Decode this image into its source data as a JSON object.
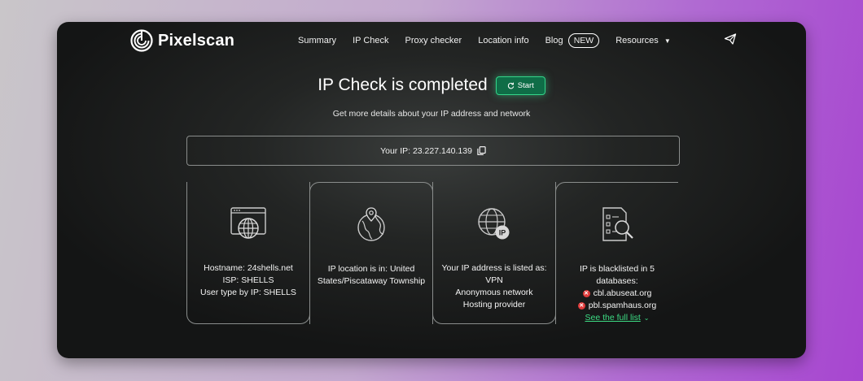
{
  "brand": {
    "name": "Pixelscan"
  },
  "nav": {
    "items": [
      {
        "label": "Summary"
      },
      {
        "label": "IP Check"
      },
      {
        "label": "Proxy checker"
      },
      {
        "label": "Location info"
      }
    ],
    "blog": {
      "label": "Blog",
      "badge": "NEW"
    },
    "resources": {
      "label": "Resources"
    }
  },
  "hero": {
    "title": "IP Check is completed",
    "start_label": "Start",
    "subtitle": "Get more details about your IP address and network"
  },
  "ip": {
    "label": "Your IP: 23.227.140.139"
  },
  "cards": [
    {
      "icon": "browser-globe-icon",
      "lines": [
        "Hostname: 24shells.net",
        "ISP: SHELLS",
        "User type by IP: SHELLS"
      ]
    },
    {
      "icon": "location-globe-icon",
      "lines": [
        "IP location is in: United States/Piscataway Township"
      ]
    },
    {
      "icon": "ip-globe-icon",
      "lines": [
        "Your IP address is listed as:",
        "VPN",
        "Anonymous network",
        "Hosting provider"
      ]
    },
    {
      "icon": "document-search-icon",
      "lines": [
        "IP is blacklisted in 5",
        "databases:"
      ],
      "databases": [
        "cbl.abuseat.org",
        "pbl.spamhaus.org"
      ],
      "link": "See the full list"
    }
  ],
  "colors": {
    "accent": "#3ddc84",
    "button": "#0f6d47",
    "error": "#e03b3b"
  }
}
